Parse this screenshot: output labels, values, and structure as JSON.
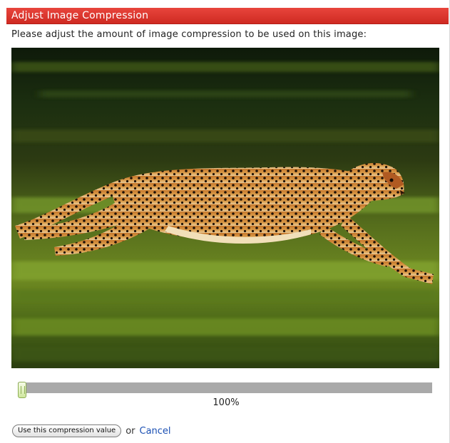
{
  "dialog": {
    "title": "Adjust Image Compression",
    "instructions": "Please adjust the amount of image compression to be used on this image:"
  },
  "image": {
    "subject": "cheetah-running"
  },
  "slider": {
    "value": 100,
    "value_label": "100%"
  },
  "actions": {
    "use_button_label": "Use this compression value",
    "or_text": "or",
    "cancel_label": "Cancel"
  },
  "colors": {
    "title_bar": "#d93a31",
    "track": "#a9a9a9",
    "thumb": "#cfe79e",
    "link": "#1a4fb3"
  }
}
